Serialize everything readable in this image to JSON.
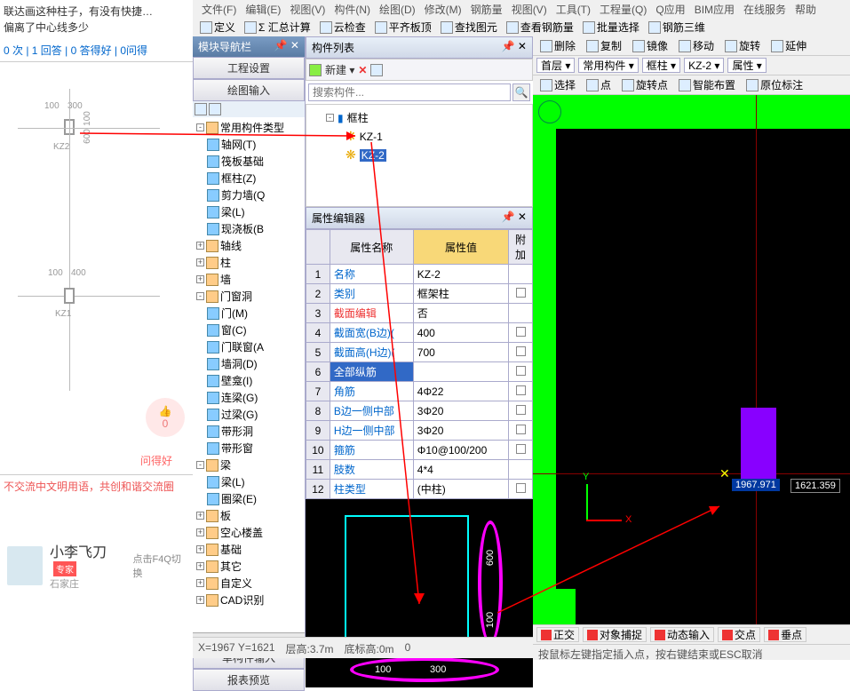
{
  "left": {
    "question_line1": "联达画这种柱子，有没有快捷…",
    "question_line2": "偏离了中心线多少",
    "stats": "0 次 | 1 回答 | 0 答得好 | 0问得",
    "kz2_label": "KZ2",
    "kz1_label": "KZ1",
    "dim_100_a": "100",
    "dim_300": "300",
    "dim_100_b": "100",
    "dim_600": "600",
    "dim_100_c": "100",
    "dim_400": "400",
    "thumb_count": "0",
    "ask_good": "问得好",
    "footer": "不交流中文明用语，共创和谐交流圈",
    "expert_name": "小李飞刀",
    "expert_tag": "专家",
    "expert_loc": "石家庄",
    "f4q": "点击F4Q切换"
  },
  "nav": {
    "title": "模块导航栏",
    "btn1": "工程设置",
    "btn2": "绘图输入",
    "single_input": "单构件输入",
    "report": "报表预览",
    "nodes": [
      {
        "l": 0,
        "exp": "-",
        "icon": "f",
        "t": "常用构件类型"
      },
      {
        "l": 1,
        "icon": "i",
        "t": "轴网(T)"
      },
      {
        "l": 1,
        "icon": "i",
        "t": "筏板基础"
      },
      {
        "l": 1,
        "icon": "i",
        "t": "框柱(Z)"
      },
      {
        "l": 1,
        "icon": "i",
        "t": "剪力墙(Q"
      },
      {
        "l": 1,
        "icon": "i",
        "t": "梁(L)"
      },
      {
        "l": 1,
        "icon": "i",
        "t": "现浇板(B"
      },
      {
        "l": 0,
        "exp": "+",
        "icon": "f",
        "t": "轴线"
      },
      {
        "l": 0,
        "exp": "+",
        "icon": "f",
        "t": "柱"
      },
      {
        "l": 0,
        "exp": "+",
        "icon": "f",
        "t": "墙"
      },
      {
        "l": 0,
        "exp": "-",
        "icon": "f",
        "t": "门窗洞"
      },
      {
        "l": 1,
        "icon": "i",
        "t": "门(M)"
      },
      {
        "l": 1,
        "icon": "i",
        "t": "窗(C)"
      },
      {
        "l": 1,
        "icon": "i",
        "t": "门联窗(A"
      },
      {
        "l": 1,
        "icon": "i",
        "t": "墙洞(D)"
      },
      {
        "l": 1,
        "icon": "i",
        "t": "壁龛(I)"
      },
      {
        "l": 1,
        "icon": "i",
        "t": "连梁(G)"
      },
      {
        "l": 1,
        "icon": "i",
        "t": "过梁(G)"
      },
      {
        "l": 1,
        "icon": "i",
        "t": "带形洞"
      },
      {
        "l": 1,
        "icon": "i",
        "t": "带形窗"
      },
      {
        "l": 0,
        "exp": "-",
        "icon": "f",
        "t": "梁"
      },
      {
        "l": 1,
        "icon": "i",
        "t": "梁(L)"
      },
      {
        "l": 1,
        "icon": "i",
        "t": "圈梁(E)"
      },
      {
        "l": 0,
        "exp": "+",
        "icon": "f",
        "t": "板"
      },
      {
        "l": 0,
        "exp": "+",
        "icon": "f",
        "t": "空心楼盖"
      },
      {
        "l": 0,
        "exp": "+",
        "icon": "f",
        "t": "基础"
      },
      {
        "l": 0,
        "exp": "+",
        "icon": "f",
        "t": "其它"
      },
      {
        "l": 0,
        "exp": "+",
        "icon": "f",
        "t": "自定义"
      },
      {
        "l": 0,
        "exp": "+",
        "icon": "f",
        "t": "CAD识别"
      }
    ]
  },
  "center": {
    "list_title": "构件列表",
    "new_btn": "新建",
    "search_placeholder": "搜索构件...",
    "root": "框柱",
    "kz1": "KZ-1",
    "kz2": "KZ-2",
    "prop_title": "属性编辑器",
    "col_name": "属性名称",
    "col_val": "属性值",
    "col_extra": "附加",
    "rows": [
      {
        "n": "1",
        "name": "名称",
        "val": "KZ-2",
        "cls": ""
      },
      {
        "n": "2",
        "name": "类别",
        "val": "框架柱",
        "cls": "",
        "chk": true
      },
      {
        "n": "3",
        "name": "截面编辑",
        "val": "否",
        "cls": "red"
      },
      {
        "n": "4",
        "name": "截面宽(B边)(",
        "val": "400",
        "cls": "",
        "chk": true
      },
      {
        "n": "5",
        "name": "截面高(H边)(",
        "val": "700",
        "cls": "",
        "chk": true
      },
      {
        "n": "6",
        "name": "全部纵筋",
        "val": "",
        "cls": "sel",
        "chk": true
      },
      {
        "n": "7",
        "name": "角筋",
        "val": "4Φ22",
        "cls": "",
        "chk": true
      },
      {
        "n": "8",
        "name": "B边一侧中部",
        "val": "3Φ20",
        "cls": "",
        "chk": true
      },
      {
        "n": "9",
        "name": "H边一侧中部",
        "val": "3Φ20",
        "cls": "",
        "chk": true
      },
      {
        "n": "10",
        "name": "箍筋",
        "val": "Φ10@100/200",
        "cls": "",
        "chk": true
      },
      {
        "n": "11",
        "name": "肢数",
        "val": "4*4",
        "cls": ""
      },
      {
        "n": "12",
        "name": "柱类型",
        "val": "(中柱)",
        "cls": "",
        "chk": true
      }
    ],
    "sec_100a": "100",
    "sec_300": "300",
    "sec_100b": "100",
    "sec_600": "600"
  },
  "top": {
    "menu": [
      "文件(F)",
      "编辑(E)",
      "视图(V)",
      "构件(N)",
      "绘图(D)",
      "修改(M)",
      "钢筋量",
      "视图(V)",
      "工具(T)",
      "工程量(Q)",
      "Q应用",
      "BIM应用",
      "在线服务",
      "帮助"
    ],
    "toolbar": [
      "定义",
      "Σ 汇总计算",
      "云检查",
      "平齐板顶",
      "查找图元",
      "查看钢筋量",
      "批量选择",
      "钢筋三维"
    ]
  },
  "right": {
    "tb1": [
      "删除",
      "复制",
      "镜像",
      "移动",
      "旋转",
      "延伸"
    ],
    "sel": [
      "首层",
      "常用构件",
      "框柱",
      "KZ-2",
      "属性"
    ],
    "tb2": [
      "选择",
      "点",
      "旋转点",
      "智能布置",
      "原位标注"
    ],
    "coord1": "1967.971",
    "coord2": "1621.359",
    "axis_x": "X",
    "axis_y": "Y",
    "status": [
      "正交",
      "对象捕捉",
      "动态输入",
      "交点",
      "垂点"
    ],
    "hint": "按鼠标左键指定插入点，按右键结束或ESC取消"
  },
  "bottom": {
    "coords": "X=1967 Y=1621",
    "floor_h": "层高:3.7m",
    "base_h": "底标高:0m",
    "zero": "0"
  }
}
